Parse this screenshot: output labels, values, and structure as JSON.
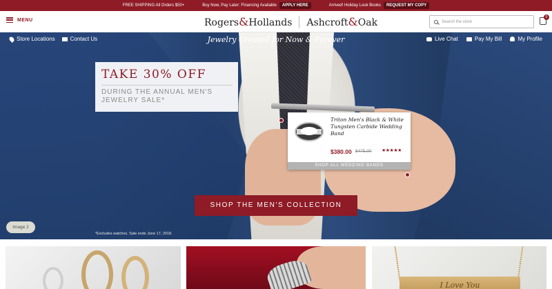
{
  "topbar": {
    "free_shipping": "FREE SHIPPING All Orders $50+",
    "financing": "Buy Now, Pay Later: Financing Available",
    "apply_here": "APPLY HERE",
    "lookbooks": "Arrived! Holiday Look Books",
    "request_copy": "REQUEST MY COPY"
  },
  "header": {
    "menu_label": "MENU",
    "logo_left_a": "Rogers",
    "logo_amp": "&",
    "logo_left_b": "Hollands",
    "logo_right_a": "Ashcroft",
    "logo_right_b": "Oak",
    "search_placeholder": "Search the store",
    "cart_count": "0"
  },
  "utility": {
    "store_locations": "Store Locations",
    "contact_us": "Contact Us",
    "tagline": "Jewelry Created for Now & Forever",
    "live_chat": "Live Chat",
    "pay_my_bill": "Pay My Bill",
    "my_profile": "My Profile"
  },
  "hero": {
    "promo_headline": "TAKE 30% OFF",
    "promo_sub_1": "DURING THE ANNUAL MEN'S",
    "promo_sub_2": "JEWELRY SALE*",
    "product_name": "Triton Men's Black & White Tungsten Carbide Wedding Band",
    "product_price": "$380.00",
    "product_was": "$475.00",
    "product_rating": 4.5,
    "product_stars": "★★★★★",
    "shop_all": "SHOP ALL WEDDING BANDS",
    "cta": "SHOP THE MEN'S COLLECTION",
    "image_pill": "Image 2",
    "disclaimer": "*Excludes watches. Sale ends June 17, 2018."
  },
  "tiles": {
    "engraving": "I Love You"
  },
  "colors": {
    "brand_red": "#8e1b26",
    "navy": "#27457a"
  }
}
